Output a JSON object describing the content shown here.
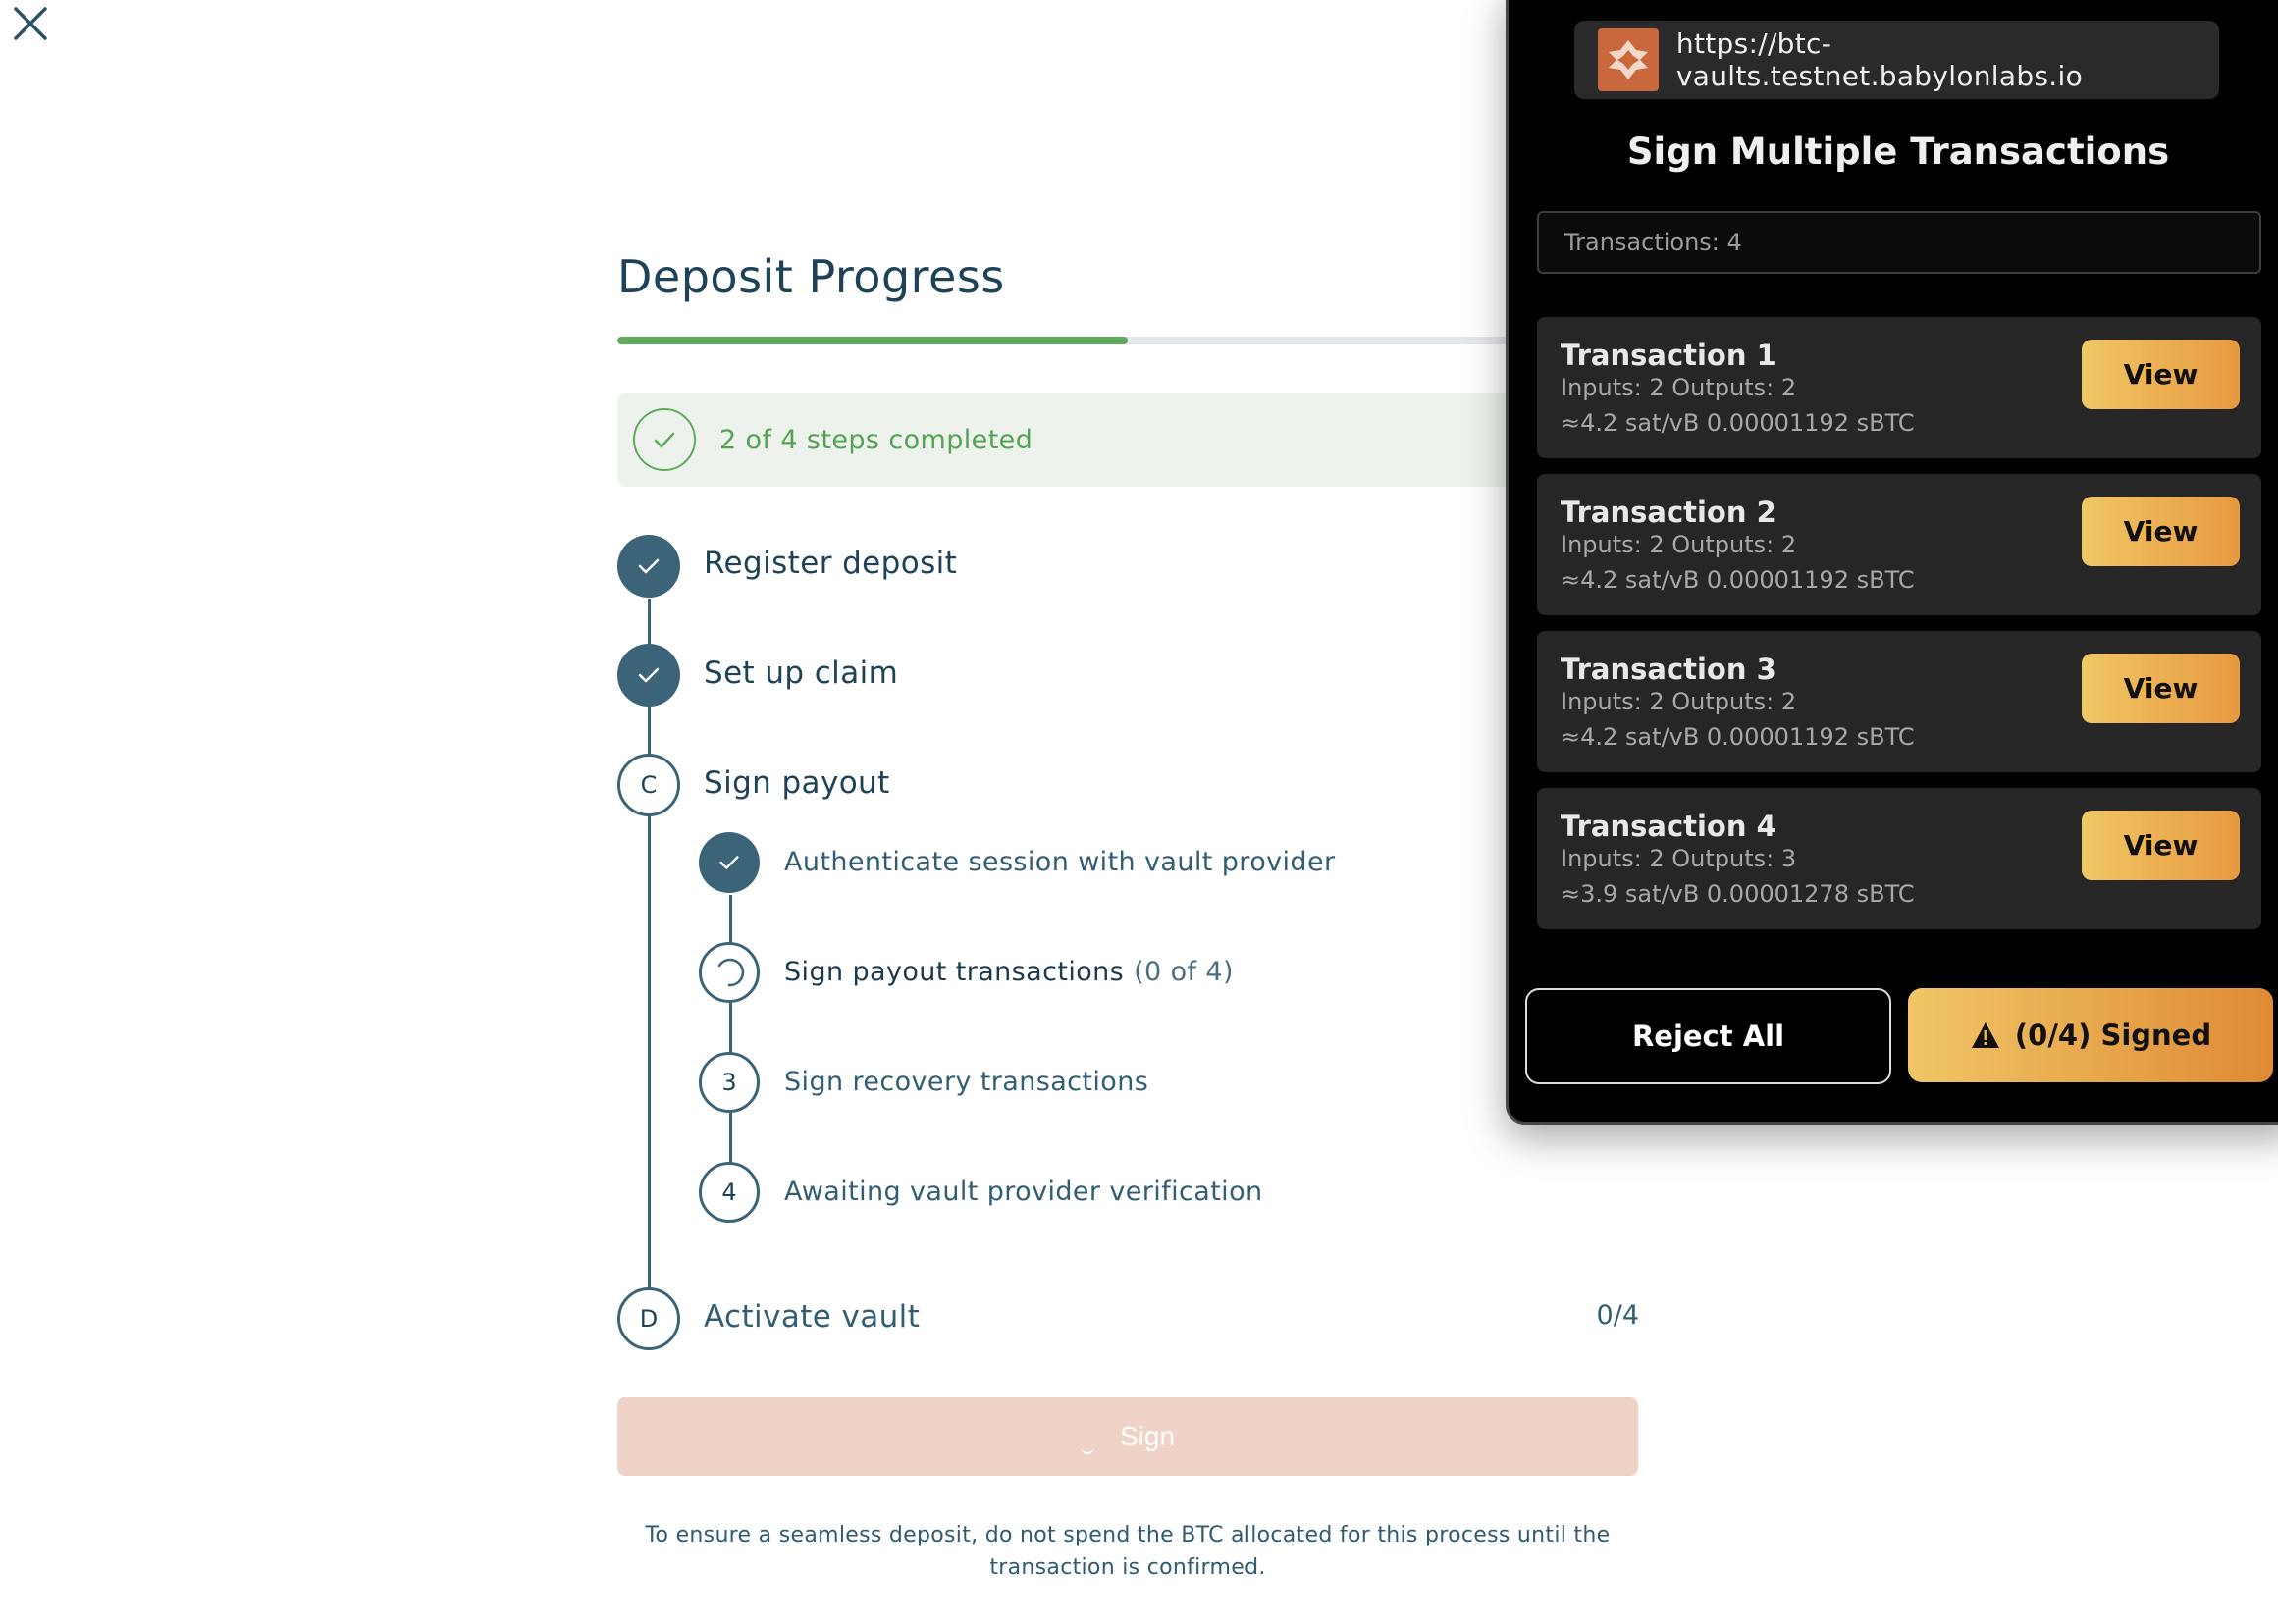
{
  "deposit": {
    "title": "Deposit Progress",
    "progress_fraction": 0.5,
    "banner_text": "2 of 4 steps completed",
    "steps": [
      {
        "marker": "",
        "label": "Register deposit",
        "state": "done"
      },
      {
        "marker": "",
        "label": "Set up claim",
        "state": "done"
      },
      {
        "marker": "C",
        "label": "Sign payout",
        "state": "current"
      },
      {
        "marker": "D",
        "label": "Activate vault",
        "state": "pending"
      }
    ],
    "substeps": [
      {
        "marker": "",
        "label": "Authenticate session with vault provider",
        "state": "done"
      },
      {
        "marker": "",
        "label": "Sign payout transactions",
        "count": "(0 of 4)",
        "state": "loading"
      },
      {
        "marker": "3",
        "label": "Sign recovery transactions",
        "state": "pending"
      },
      {
        "marker": "4",
        "label": "Awaiting vault provider verification",
        "state": "pending"
      }
    ],
    "vault_count": "0/4",
    "sign_label": "Sign",
    "footer_note": "To ensure a seamless deposit, do not spend the BTC allocated for this process until the transaction is confirmed."
  },
  "popup": {
    "url": "https://btc-vaults.testnet.babylonlabs.io",
    "title": "Sign Multiple Transactions",
    "count_text": "Transactions: 4",
    "transactions": [
      {
        "title": "Transaction 1",
        "io": "Inputs: 2  Outputs: 2",
        "fee": "≈4.2 sat/vB  0.00001192 sBTC",
        "view": "View"
      },
      {
        "title": "Transaction 2",
        "io": "Inputs: 2  Outputs: 2",
        "fee": "≈4.2 sat/vB  0.00001192 sBTC",
        "view": "View"
      },
      {
        "title": "Transaction 3",
        "io": "Inputs: 2  Outputs: 2",
        "fee": "≈4.2 sat/vB  0.00001192 sBTC",
        "view": "View"
      },
      {
        "title": "Transaction 4",
        "io": "Inputs: 2  Outputs: 3",
        "fee": "≈3.9 sat/vB  0.00001278 sBTC",
        "view": "View"
      }
    ],
    "reject_label": "Reject All",
    "signed_label": "(0/4) Signed"
  },
  "colors": {
    "timeline": "#3c6479",
    "success": "#5eac5a",
    "accent_start": "#f0c666",
    "accent_end": "#e8993f",
    "sign_disabled": "#efd3c6"
  },
  "icons": [
    "close-icon",
    "check-icon",
    "spinner-icon",
    "site-logo-icon",
    "warning-icon"
  ]
}
